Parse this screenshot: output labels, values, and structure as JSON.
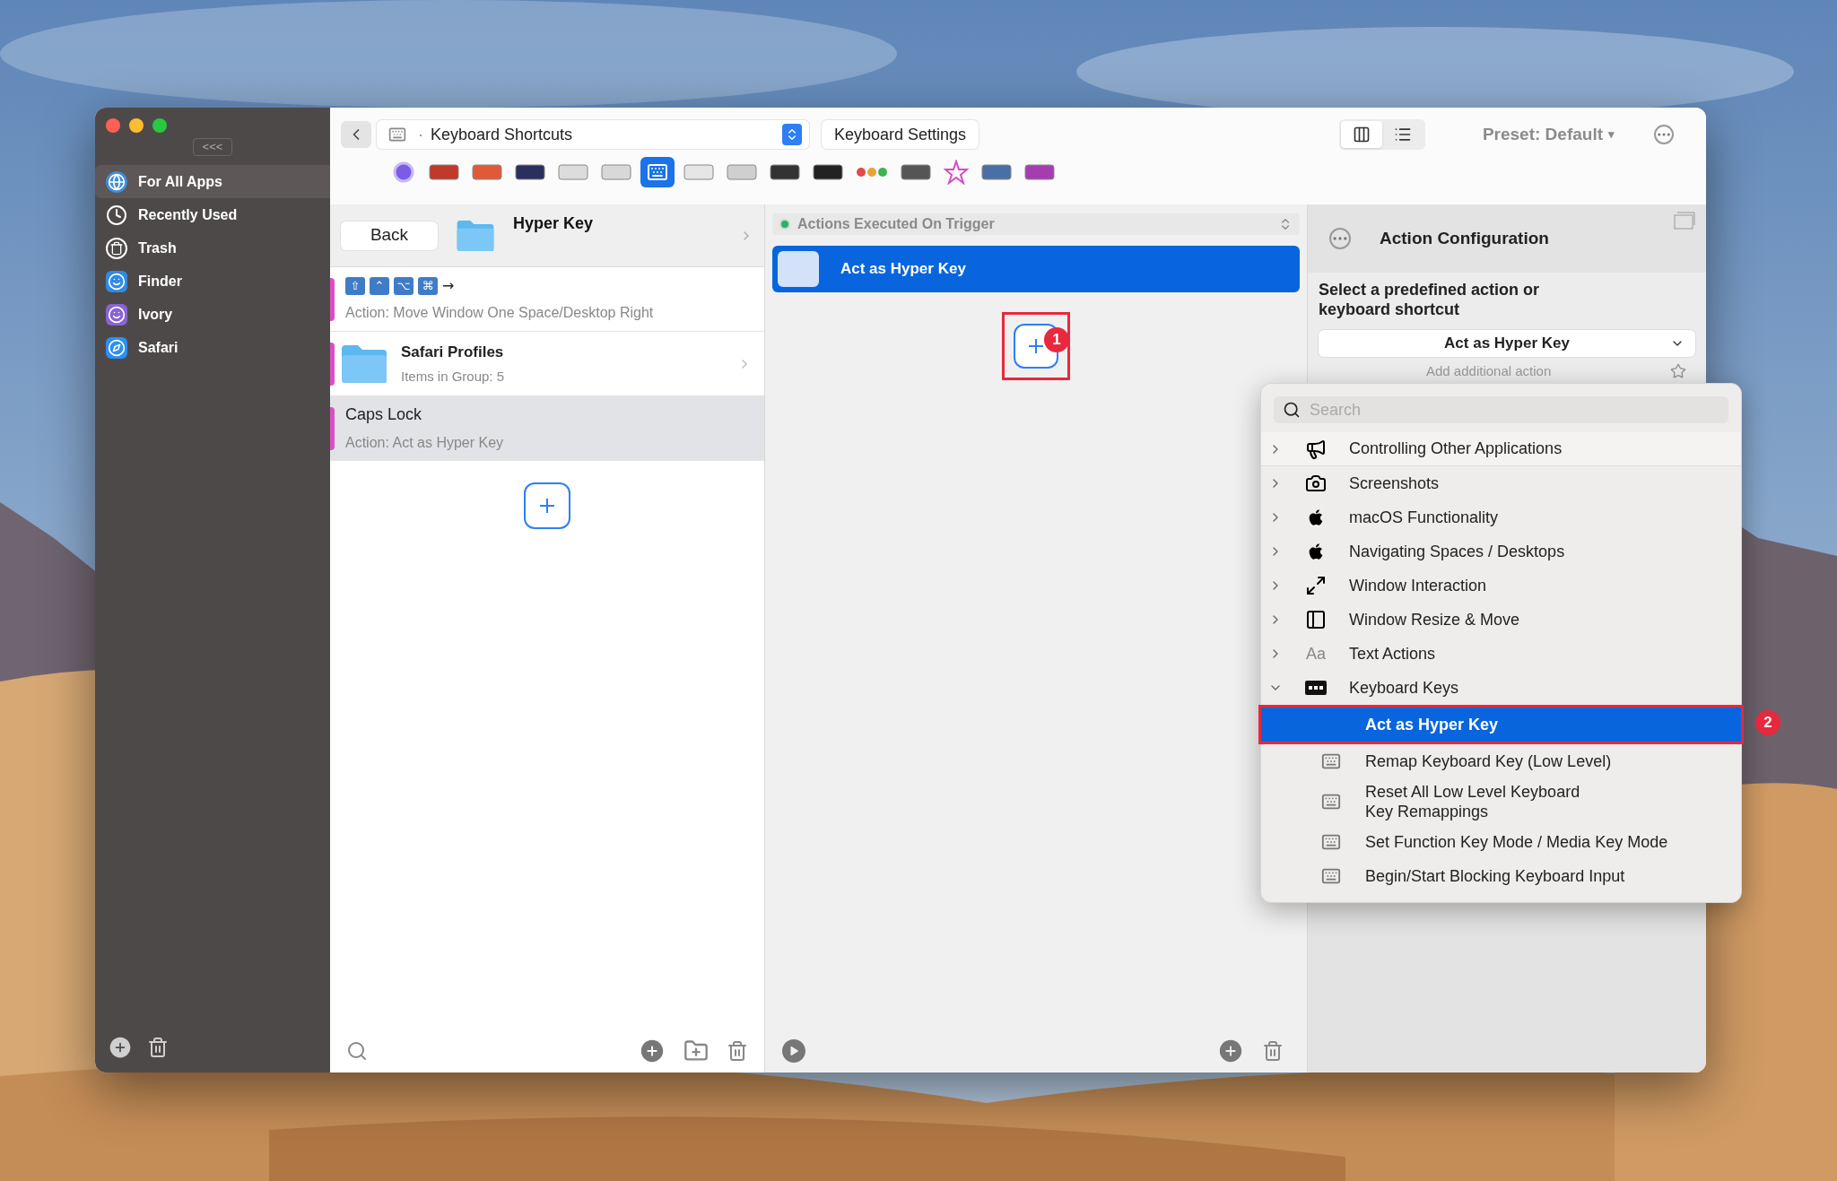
{
  "sidebar": {
    "collapse_label": "<<<",
    "items": [
      {
        "label": "For All Apps",
        "selected": true
      },
      {
        "label": "Recently Used",
        "selected": false
      },
      {
        "label": "Trash",
        "selected": false
      },
      {
        "label": "Finder",
        "selected": false
      },
      {
        "label": "Ivory",
        "selected": false
      },
      {
        "label": "Safari",
        "selected": false
      }
    ]
  },
  "toolbar": {
    "dropdown": {
      "prefix": "·",
      "value": "Keyboard Shortcuts"
    },
    "settings_button": "Keyboard Settings",
    "preset": "Preset: Default",
    "preset_caret": "▾",
    "view_modes": [
      {
        "kind": "columns",
        "selected": true
      },
      {
        "kind": "list",
        "selected": false
      }
    ],
    "trigger_types": [
      {
        "selected": false
      },
      {
        "selected": false
      },
      {
        "selected": false
      },
      {
        "selected": false
      },
      {
        "selected": false
      },
      {
        "selected": false
      },
      {
        "selected": true
      },
      {
        "selected": false
      },
      {
        "selected": false
      },
      {
        "selected": false
      },
      {
        "selected": false
      },
      {
        "selected": false
      },
      {
        "selected": false
      },
      {
        "selected": false
      },
      {
        "selected": false
      },
      {
        "selected": false
      }
    ]
  },
  "trigger_list": {
    "back_button": "Back",
    "group_title": "Hyper Key",
    "rows": [
      {
        "kind": "shortcut",
        "keys": [
          "⇧",
          "⌃",
          "⌥",
          "⌘"
        ],
        "arrow": "→",
        "subtitle": "Action: Move Window One Space/Desktop Right",
        "selected": false
      },
      {
        "kind": "group",
        "title": "Safari Profiles",
        "subtitle": "Items in Group: 5",
        "selected": false
      },
      {
        "kind": "trigger",
        "title": "Caps Lock",
        "subtitle": "Action: Act as Hyper Key",
        "selected": true
      }
    ]
  },
  "actions": {
    "header": "Actions Executed On Trigger",
    "items": [
      {
        "label": "Act as Hyper Key",
        "selected": true
      }
    ],
    "add_annotation": "1"
  },
  "config": {
    "title": "Action Configuration",
    "prompt": "Select a predefined action or keyboard shortcut",
    "action_select": "Act as Hyper Key",
    "add_action": "Add additional action"
  },
  "action_menu": {
    "search": {
      "placeholder": "Search"
    },
    "categories": [
      {
        "kind": "megaphone",
        "label": "Controlling Other Applications",
        "expanded": false
      },
      {
        "kind": "camera",
        "label": "Screenshots",
        "expanded": false
      },
      {
        "kind": "apple",
        "label": "macOS Functionality",
        "expanded": false
      },
      {
        "kind": "apple",
        "label": "Navigating Spaces / Desktops",
        "expanded": false
      },
      {
        "kind": "arrows",
        "label": "Window Interaction",
        "expanded": false
      },
      {
        "kind": "panel",
        "label": "Window Resize & Move",
        "expanded": false
      },
      {
        "kind": "text",
        "glyph": "Aa",
        "label": "Text Actions",
        "expanded": false
      },
      {
        "kind": "abc",
        "label": "Keyboard Keys",
        "expanded": true,
        "children": [
          {
            "label": "Act as Hyper Key",
            "selected": true,
            "annotation": "2"
          },
          {
            "label": "Remap Keyboard Key (Low Level)",
            "selected": false
          },
          {
            "label": "Reset All Low Level Keyboard\nKey Remappings",
            "selected": false
          },
          {
            "label": "Set Function Key Mode / Media Key Mode",
            "selected": false
          },
          {
            "label": "Begin/Start Blocking Keyboard Input",
            "selected": false
          }
        ]
      }
    ]
  }
}
